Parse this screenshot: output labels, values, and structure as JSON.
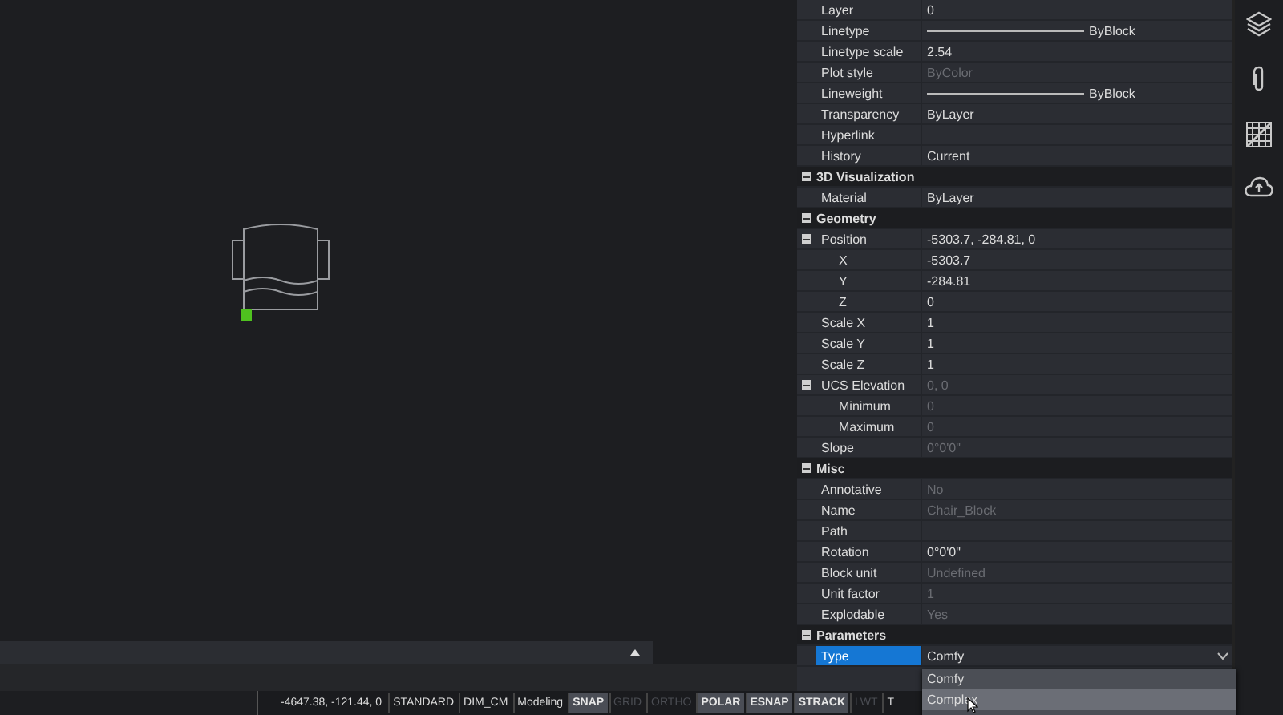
{
  "properties": {
    "rows": [
      {
        "kind": "property",
        "label": "Layer",
        "value": "0",
        "selected": false
      },
      {
        "kind": "line",
        "label": "Linetype",
        "value": "ByBlock",
        "selected": false
      },
      {
        "kind": "property",
        "label": "Linetype scale",
        "value": "2.54",
        "selected": false
      },
      {
        "kind": "property",
        "label": "Plot style",
        "value": "ByColor",
        "dimmed": true,
        "selected": false
      },
      {
        "kind": "line",
        "label": "Lineweight",
        "value": "ByBlock",
        "selected": false
      },
      {
        "kind": "property",
        "label": "Transparency",
        "value": "ByLayer",
        "selected": false
      },
      {
        "kind": "property",
        "label": "Hyperlink",
        "selected": false
      },
      {
        "kind": "property",
        "label": "History",
        "value": "Current",
        "selected": false
      },
      {
        "kind": "section",
        "label": "3D Visualization",
        "expanded": true
      },
      {
        "kind": "property",
        "label": "Material",
        "value": "ByLayer",
        "selected": false
      },
      {
        "kind": "section",
        "label": "Geometry",
        "expanded": true
      },
      {
        "kind": "property",
        "label": "Position",
        "value": "-5303.7, -284.81, 0",
        "selected": false,
        "expanded": true,
        "children": [
          {
            "kind": "property",
            "label": "X",
            "value": "-5303.7",
            "selected": false
          },
          {
            "kind": "property",
            "label": "Y",
            "value": "-284.81",
            "selected": false
          },
          {
            "kind": "property",
            "label": "Z",
            "value": "0",
            "selected": false
          }
        ]
      },
      {
        "kind": "property",
        "label": "Scale X",
        "value": "1",
        "selected": false
      },
      {
        "kind": "property",
        "label": "Scale Y",
        "value": "1",
        "selected": false
      },
      {
        "kind": "property",
        "label": "Scale Z",
        "value": "1",
        "selected": false
      },
      {
        "kind": "property",
        "label": "UCS Elevation",
        "value": "0, 0",
        "dimmed": true,
        "selected": false,
        "expanded": true,
        "children": [
          {
            "kind": "property",
            "label": "Minimum",
            "value": "0",
            "dimmed": true,
            "selected": false
          },
          {
            "kind": "property",
            "label": "Maximum",
            "value": "0",
            "dimmed": true,
            "selected": false
          }
        ]
      },
      {
        "kind": "property",
        "label": "Slope",
        "value": "0°0'0\"",
        "dimmed": true,
        "selected": false
      },
      {
        "kind": "section",
        "label": "Misc",
        "expanded": true
      },
      {
        "kind": "property",
        "label": "Annotative",
        "value": "No",
        "dimmed": true,
        "selected": false
      },
      {
        "kind": "property",
        "label": "Name",
        "value": "Chair_Block",
        "dimmed": true,
        "selected": false
      },
      {
        "kind": "property",
        "label": "Path",
        "selected": false
      },
      {
        "kind": "property",
        "label": "Rotation",
        "value": "0°0'0\"",
        "selected": false
      },
      {
        "kind": "property",
        "label": "Block unit",
        "value": "Undefined",
        "dimmed": true,
        "selected": false
      },
      {
        "kind": "property",
        "label": "Unit factor",
        "value": "1",
        "dimmed": true,
        "selected": false
      },
      {
        "kind": "property",
        "label": "Explodable",
        "value": "Yes",
        "dimmed": true,
        "selected": false
      },
      {
        "kind": "section",
        "label": "Parameters",
        "expanded": true
      },
      {
        "kind": "dropdown",
        "label": "Type",
        "value": "Comfy",
        "selected": true
      }
    ],
    "dropdown_options": [
      {
        "label": "Comfy",
        "selected": false
      },
      {
        "label": "Complex",
        "selected": true
      }
    ]
  },
  "status_bar": {
    "coordinates": "-4647.38, -121.44, 0",
    "items": [
      {
        "label": "STANDARD",
        "kind": "text"
      },
      {
        "label": "DIM_CM",
        "kind": "text"
      },
      {
        "label": "Modeling",
        "kind": "text"
      },
      {
        "label": "SNAP",
        "on": true,
        "kind": "toggle"
      },
      {
        "label": "GRID",
        "on": false,
        "kind": "toggle"
      },
      {
        "label": "ORTHO",
        "on": false,
        "kind": "toggle"
      },
      {
        "label": "POLAR",
        "on": true,
        "kind": "toggle"
      },
      {
        "label": "ESNAP",
        "on": true,
        "kind": "toggle"
      },
      {
        "label": "STRACK",
        "on": true,
        "kind": "toggle"
      },
      {
        "label": "LWT",
        "on": false,
        "kind": "toggle"
      },
      {
        "label": "T",
        "kind": "text"
      }
    ]
  }
}
